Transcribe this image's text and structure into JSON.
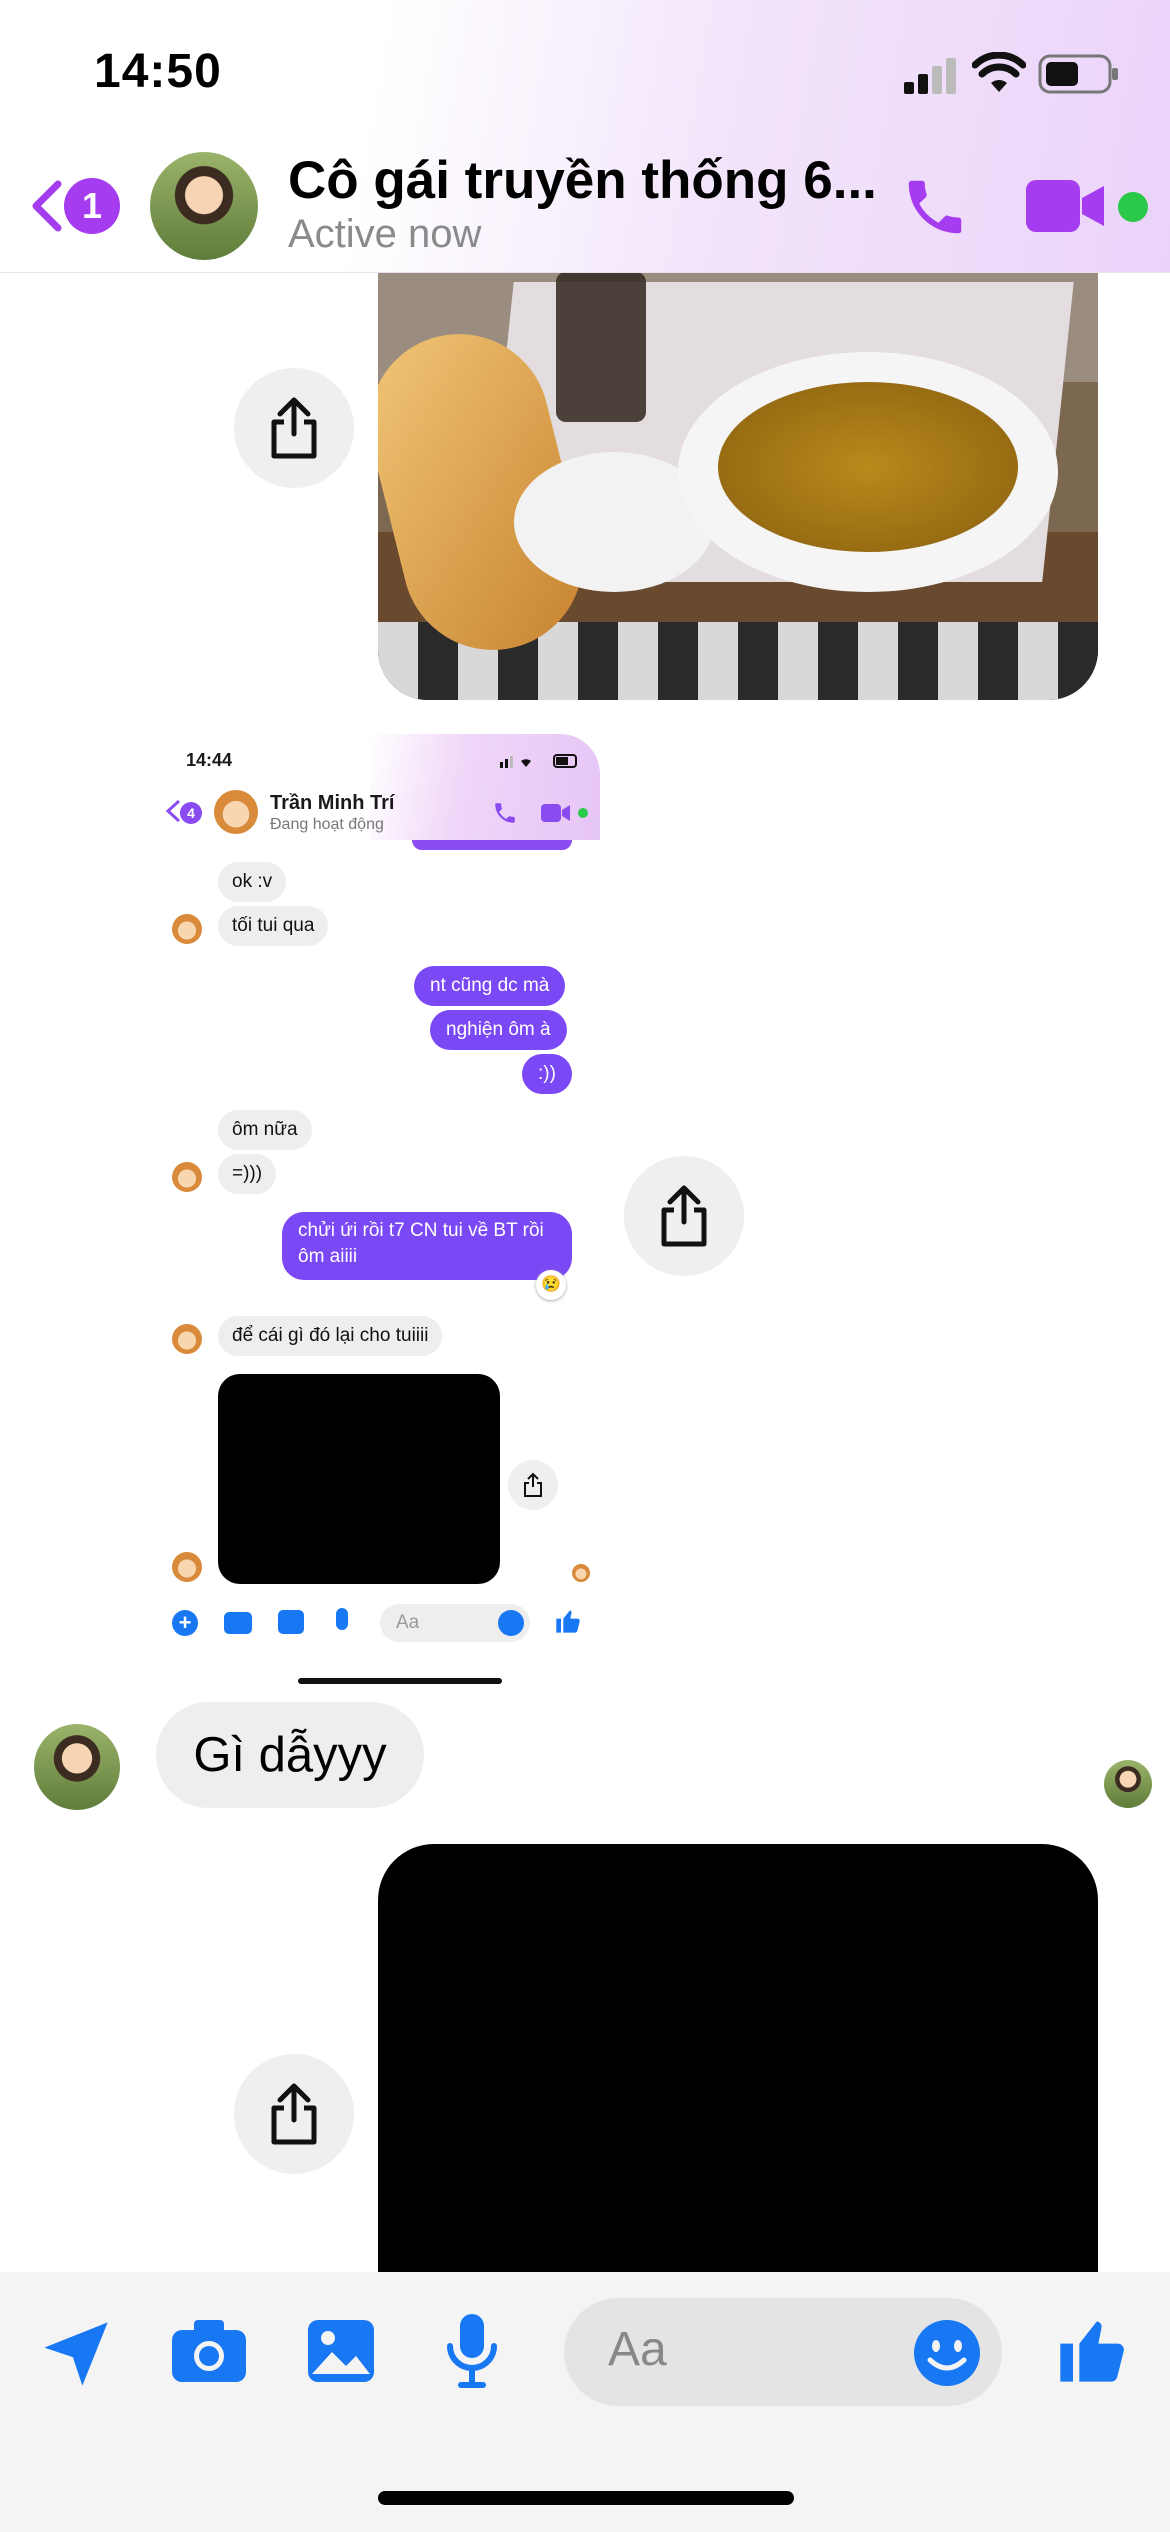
{
  "status_bar": {
    "time": "14:50"
  },
  "header": {
    "title": "Cô gái truyền thống 6...",
    "subtitle": "Active now",
    "unread_badge": "1",
    "accent_color": "#a53cf0"
  },
  "embedded_screenshot": {
    "time": "14:44",
    "unread_badge": "4",
    "contact_name": "Trần Minh Trí",
    "contact_status": "Đang hoạt động",
    "messages": [
      {
        "from": "them",
        "text": "ok :v"
      },
      {
        "from": "them",
        "text": "tối tui qua"
      },
      {
        "from": "me",
        "text": "nt cũng dc mà"
      },
      {
        "from": "me",
        "text": "nghiện ôm à"
      },
      {
        "from": "me",
        "text": ":))"
      },
      {
        "from": "them",
        "text": "ôm nữa"
      },
      {
        "from": "them",
        "text": "=)))"
      },
      {
        "from": "me",
        "text_line1": "chửi ứi rồi t7 CN tui về BT rồi",
        "text_line2": "ôm aiiii",
        "reaction": "😢"
      },
      {
        "from": "them",
        "text": "để cái gì đó lại cho tuiiii"
      }
    ],
    "input_placeholder": "Aa",
    "bubble_color": "#7b48f5"
  },
  "messages": [
    {
      "from": "them",
      "text": "Gì dẫyyy"
    }
  ],
  "composer": {
    "placeholder": "Aa",
    "icon_color": "#1877f2"
  },
  "icons": [
    "back-chevron-icon",
    "phone-icon",
    "video-camera-icon",
    "online-dot-icon",
    "share-icon",
    "send-location-icon",
    "camera-icon",
    "gallery-icon",
    "microphone-icon",
    "emoji-icon",
    "thumbs-up-icon"
  ]
}
